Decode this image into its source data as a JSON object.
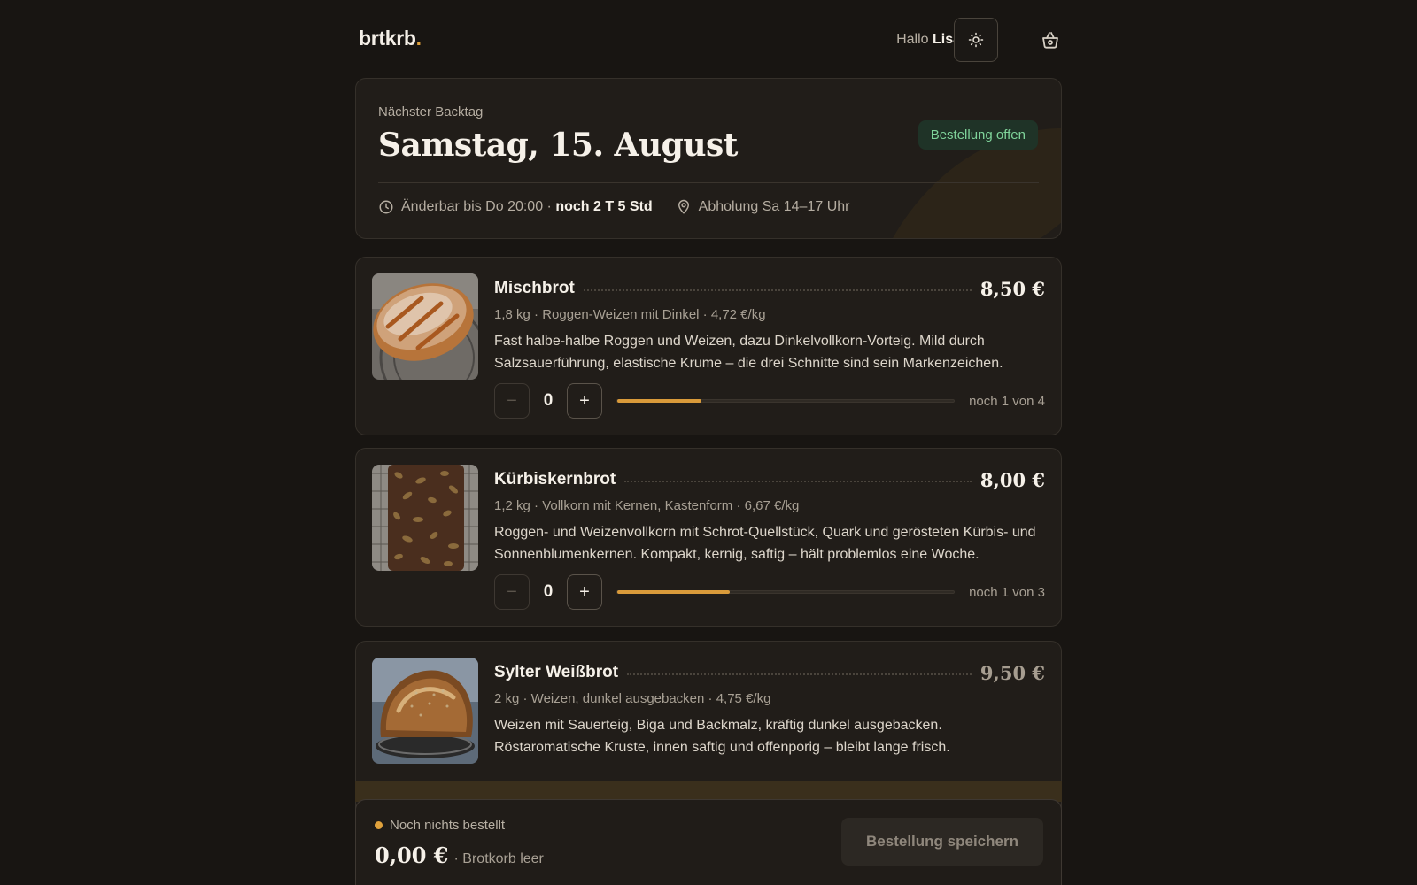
{
  "header": {
    "logo_text": "brtkrb",
    "logo_dot": ".",
    "greeting_prefix": "Hallo",
    "user_name": "Lisa",
    "theme_icon": "sun-icon",
    "cart_icon": "basket-icon"
  },
  "bake_day": {
    "label": "Nächster Backtag",
    "date": "Samstag, 15. August",
    "status_badge": "Bestellung offen",
    "deadline_text": "Änderbar bis Do 20:00 ·",
    "countdown": "noch 2 T 5 Std",
    "pickup": "Abholung Sa 14–17 Uhr"
  },
  "products": [
    {
      "name": "Mischbrot",
      "price": "8,50 €",
      "meta": "1,8 kg · Roggen-Weizen mit Dinkel · 4,72 €/kg",
      "description": "Fast halbe-halbe Roggen und Weizen, dazu Dinkelvollkorn-Vorteig. Mild durch Salzsauerführung, elastische Krume – die drei Schnitte sind sein Markenzeichen.",
      "quantity": "0",
      "minus": "−",
      "plus": "+",
      "availability": "noch 1 von 4",
      "availability_fraction": 0.25
    },
    {
      "name": "Kürbiskernbrot",
      "price": "8,00 €",
      "meta": "1,2 kg · Vollkorn mit Kernen, Kastenform · 6,67 €/kg",
      "description": "Roggen- und Weizenvollkorn mit Schrot-Quellstück, Quark und gerösteten Kürbis- und Sonnenblumenkernen. Kompakt, kernig, saftig – hält problemlos eine Woche.",
      "quantity": "0",
      "minus": "−",
      "plus": "+",
      "availability": "noch 1 von 3",
      "availability_fraction": 0.333
    },
    {
      "name": "Sylter Weißbrot",
      "price": "9,50 €",
      "meta": "2 kg · Weizen, dunkel ausgebacken · 4,75 €/kg",
      "description": "Weizen mit Sauerteig, Biga und Backmalz, kräftig dunkel ausgebacken. Röstaromatische Kruste, innen saftig und offenporig – bleibt lange frisch."
    }
  ],
  "order": {
    "status": "Noch nichts bestellt",
    "total": "0,00 €",
    "total_note": "· Brotkorb leer",
    "save_label": "Bestellung speichern"
  },
  "colors": {
    "background": "#181512",
    "card": "#211d19",
    "accent": "#d99a3a",
    "badge_bg": "#1f3327",
    "badge_text": "#7fd39a"
  }
}
